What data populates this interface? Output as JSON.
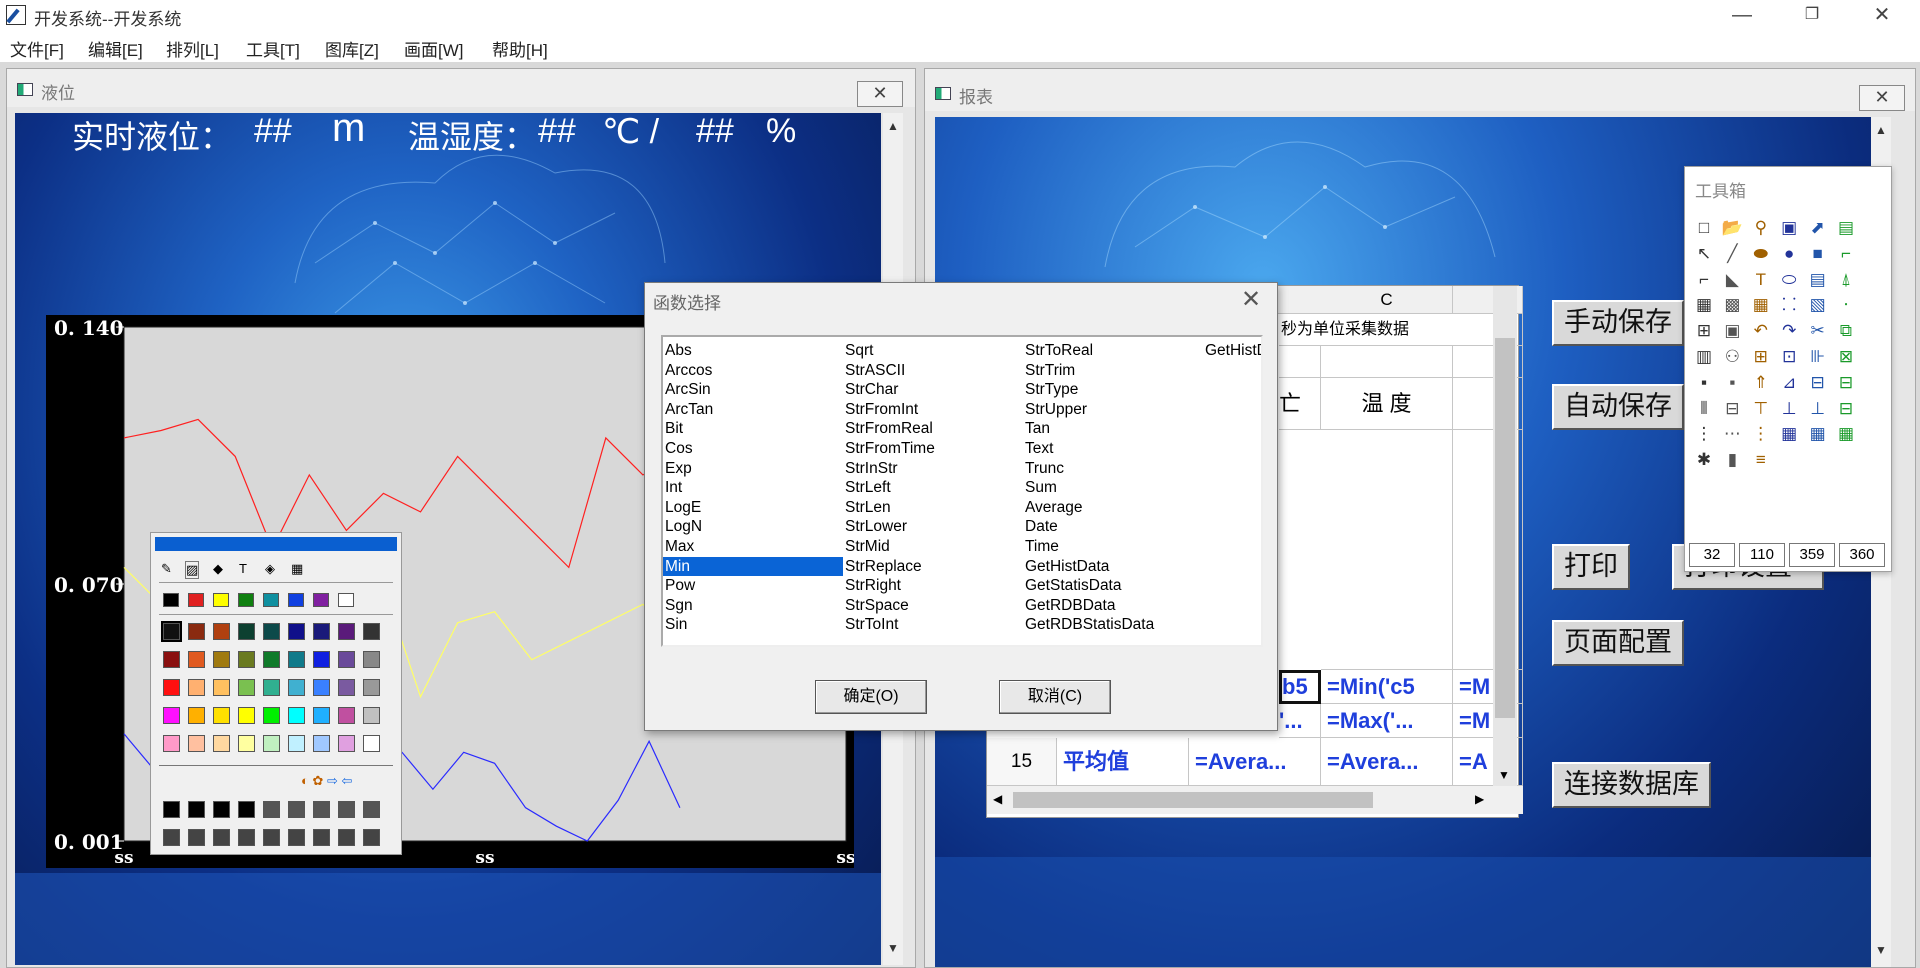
{
  "window": {
    "title": "开发系统--开发系统",
    "minimize": "—",
    "maximize": "❐",
    "close": "✕"
  },
  "menu": [
    "文件[F]",
    "编辑[E]",
    "排列[L]",
    "工具[T]",
    "图库[Z]",
    "画面[W]",
    "帮助[H]"
  ],
  "liquid_window": {
    "title": "液位",
    "close_label": "✕",
    "realtime": {
      "label": "实时液位：",
      "level_value": "##",
      "level_unit": "m",
      "th_label": "温湿度：",
      "temp_value": "##",
      "temp_unit": "℃ /",
      "hum_value": "##",
      "hum_unit": "%"
    }
  },
  "chart_data": {
    "type": "line",
    "ylim": [
      0.001,
      0.14
    ],
    "y_tick_labels": [
      "0. 140",
      "0. 070",
      "0. 001"
    ],
    "x_tick_labels": [
      "ss",
      "ss",
      "ss"
    ],
    "grid": false,
    "series": [
      {
        "color": "#ff2020",
        "values": [
          0.11,
          0.112,
          0.115,
          0.105,
          0.08,
          0.1,
          0.085,
          0.095,
          0.09,
          0.105,
          0.095,
          0.085,
          0.075,
          0.11,
          0.1,
          0.105
        ]
      },
      {
        "color": "#ffff66",
        "values": [
          0.075,
          0.065,
          0.06,
          0.055,
          0.05,
          0.06,
          0.065,
          0.07,
          0.04,
          0.06,
          0.063,
          0.05,
          0.055,
          0.06,
          0.065,
          0.055
        ]
      },
      {
        "color": "#2a2aff",
        "values": [
          0.03,
          0.02,
          0.015,
          0.01,
          0.025,
          0.02,
          0.015,
          0.018,
          0.03,
          0.025,
          0.015,
          0.025,
          0.022,
          0.01,
          0.005,
          0.001,
          0.012,
          0.028,
          0.01
        ]
      }
    ]
  },
  "palette": {
    "title_color": "#0a5fd0",
    "row1": [
      "#000000",
      "#e02020",
      "#ffff00",
      "#108010",
      "#1090a0",
      "#1040e0",
      "#8020a0",
      "#ffffff"
    ],
    "grid": [
      [
        "#111111",
        "#8a2a10",
        "#b04010",
        "#0d4030",
        "#0d4a4a",
        "#10108a",
        "#1a1a7a",
        "#5a1a7a",
        "#333333"
      ],
      [
        "#8a1010",
        "#e05a20",
        "#a07a10",
        "#6a7a20",
        "#107a2a",
        "#107a8a",
        "#1020e0",
        "#6a4a9a",
        "#888888"
      ],
      [
        "#ff1010",
        "#ffb070",
        "#ffc060",
        "#7ac050",
        "#30b090",
        "#40b0d0",
        "#3a80ff",
        "#7a5aa0",
        "#999999"
      ],
      [
        "#ff10ff",
        "#ffb000",
        "#ffe000",
        "#ffff00",
        "#00f000",
        "#00ffff",
        "#20b0ff",
        "#c050a0",
        "#c0c0c0"
      ],
      [
        "#ff9ac8",
        "#ffc0a0",
        "#ffd8a0",
        "#ffffa0",
        "#c0f0c0",
        "#c0f0ff",
        "#a0c8ff",
        "#e0a0e0",
        "#ffffff"
      ]
    ],
    "bottom": [
      [
        "#000000",
        "#000000",
        "#000000",
        "#000000",
        "#555555",
        "#555555",
        "#555555",
        "#555555",
        "#555555"
      ],
      [
        "#444444",
        "#444444",
        "#444444",
        "#444444",
        "#444444",
        "#444444",
        "#444444",
        "#444444",
        "#444444"
      ]
    ]
  },
  "dialog": {
    "title": "函数选择",
    "close": "✕",
    "columns": [
      [
        "Abs",
        "Arccos",
        "ArcSin",
        "ArcTan",
        "Bit",
        "Cos",
        "Exp",
        "Int",
        "LogE",
        "LogN",
        "Max",
        "Min",
        "Pow",
        "Sgn",
        "Sin"
      ],
      [
        "Sqrt",
        "StrASCII",
        "StrChar",
        "StrFromInt",
        "StrFromReal",
        "StrFromTime",
        "StrInStr",
        "StrLeft",
        "StrLen",
        "StrLower",
        "StrMid",
        "StrReplace",
        "StrRight",
        "StrSpace",
        "StrToInt"
      ],
      [
        "StrToReal",
        "StrTrim",
        "StrType",
        "StrUpper",
        "Tan",
        "Text",
        "Trunc",
        "Sum",
        "Average",
        "Date",
        "Time",
        "GetHistData",
        "GetStatisData",
        "GetRDBData",
        "GetRDBStatisData"
      ],
      [
        "GetHistD"
      ]
    ],
    "selected": "Min",
    "ok": "确定(O)",
    "cancel": "取消(C)"
  },
  "report_window": {
    "title": "报表",
    "close_label": "✕",
    "sheet": {
      "col_c": "C",
      "caption": "秒为单位采集数据",
      "header_partial": "亡",
      "temp_header": "温 度",
      "row_num": "15",
      "row_label": "平均值",
      "cells": {
        "r13_b": "b5",
        "r13_c": "=Min('c5",
        "r13_d": "=M",
        "r14_b": "'...",
        "r14_c": "=Max('...",
        "r14_d": "=M",
        "r15_b": "=Avera...",
        "r15_c": "=Avera...",
        "r15_d": "=A"
      }
    },
    "buttons": {
      "manual_save": "手动保存",
      "auto_save": "自动保存",
      "print": "打印",
      "page_config": "页面配置",
      "connect_db": "连接数据库",
      "hidden_btn": "打印设置"
    }
  },
  "toolbox": {
    "title": "工具箱",
    "fields": [
      "32",
      "110",
      "359",
      "360"
    ]
  }
}
